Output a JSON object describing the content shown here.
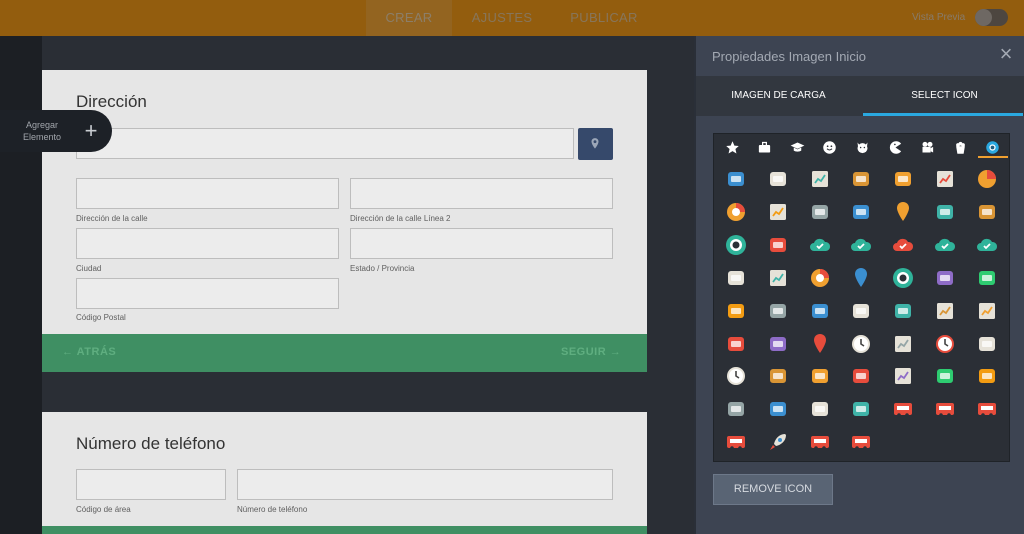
{
  "topbar": {
    "tabs": [
      "CREAR",
      "AJUSTES",
      "PUBLICAR"
    ],
    "preview_label": "Vista Previa"
  },
  "sidebar": {
    "add_element_label": "Agregar Elemento",
    "add_element_icon": "plus-icon"
  },
  "address_card": {
    "title": "Dirección",
    "labels": {
      "street": "Dirección de la calle",
      "street2": "Dirección de la calle Línea 2",
      "city": "Ciudad",
      "state": "Estado / Provincia",
      "postal": "Código Postal"
    },
    "back_label": "ATRÁS",
    "next_label": "SEGUIR",
    "location_icon": "map-pin-icon"
  },
  "phone_card": {
    "title": "Número de teléfono",
    "labels": {
      "area": "Código de área",
      "number": "Número de teléfono"
    }
  },
  "panel": {
    "title": "Propiedades Imagen Inicio",
    "tabs": [
      "IMAGEN DE CARGA",
      "SELECT ICON"
    ],
    "active_tab": "SELECT ICON",
    "categories": [
      "star-icon",
      "briefcase-icon",
      "graduation-cap-icon",
      "smiley-icon",
      "dog-icon",
      "pacman-icon",
      "camera-icon",
      "popcorn-icon",
      "flat-icon"
    ],
    "active_category": "flat-icon",
    "icons": [
      "id-card-icon",
      "bank-icon",
      "presentation-board-icon",
      "briefcase-icon",
      "building-icon",
      "growth-chart-icon",
      "pie-chart-icon",
      "donut-chart-icon",
      "laptop-chart-icon",
      "money-icon",
      "price-tag-icon",
      "map-pin-icon",
      "map-icon",
      "open-mail-icon",
      "camera-lens-icon",
      "card-reader-icon",
      "cloud-check-icon",
      "cloud-download-icon",
      "cloud-remove-icon",
      "cloud-sync-icon",
      "cloud-upload-icon",
      "certificate-icon",
      "notepad-icon",
      "donut-icon",
      "water-drop-icon",
      "eye-icon",
      "foam-finger-icon",
      "burger-icon",
      "hotdog-icon",
      "muffin-icon",
      "pizza-slice-icon",
      "traffic-light-icon",
      "yin-yang-icon",
      "presentation-chart-icon",
      "brochure-icon",
      "computer-icon",
      "target-icon",
      "push-pin-icon",
      "clock-icon",
      "calculator-icon",
      "alarm-clock-icon",
      "light-bulb-icon",
      "stopwatch-icon",
      "column-icon",
      "backpack-icon",
      "gift-box-icon",
      "receipt-icon",
      "handbag-icon",
      "reading-person-icon",
      "swiss-knife-icon",
      "first-aid-kit-icon",
      "ticket-icon",
      "shop-icon",
      "toaster-icon",
      "radio-icon",
      "cash-register-icon",
      "cash-machine-icon",
      "rocket-icon",
      "bus-icon",
      "fire-truck-icon"
    ],
    "active_icon": "camera-lens-icon",
    "remove_label": "REMOVE ICON"
  },
  "colors": {
    "topbar": "#ff9800",
    "panel": "#3d4452",
    "accent_blue": "#2aa8e0",
    "accent_orange": "#f0a030",
    "footer_green": "#3f8f63"
  }
}
